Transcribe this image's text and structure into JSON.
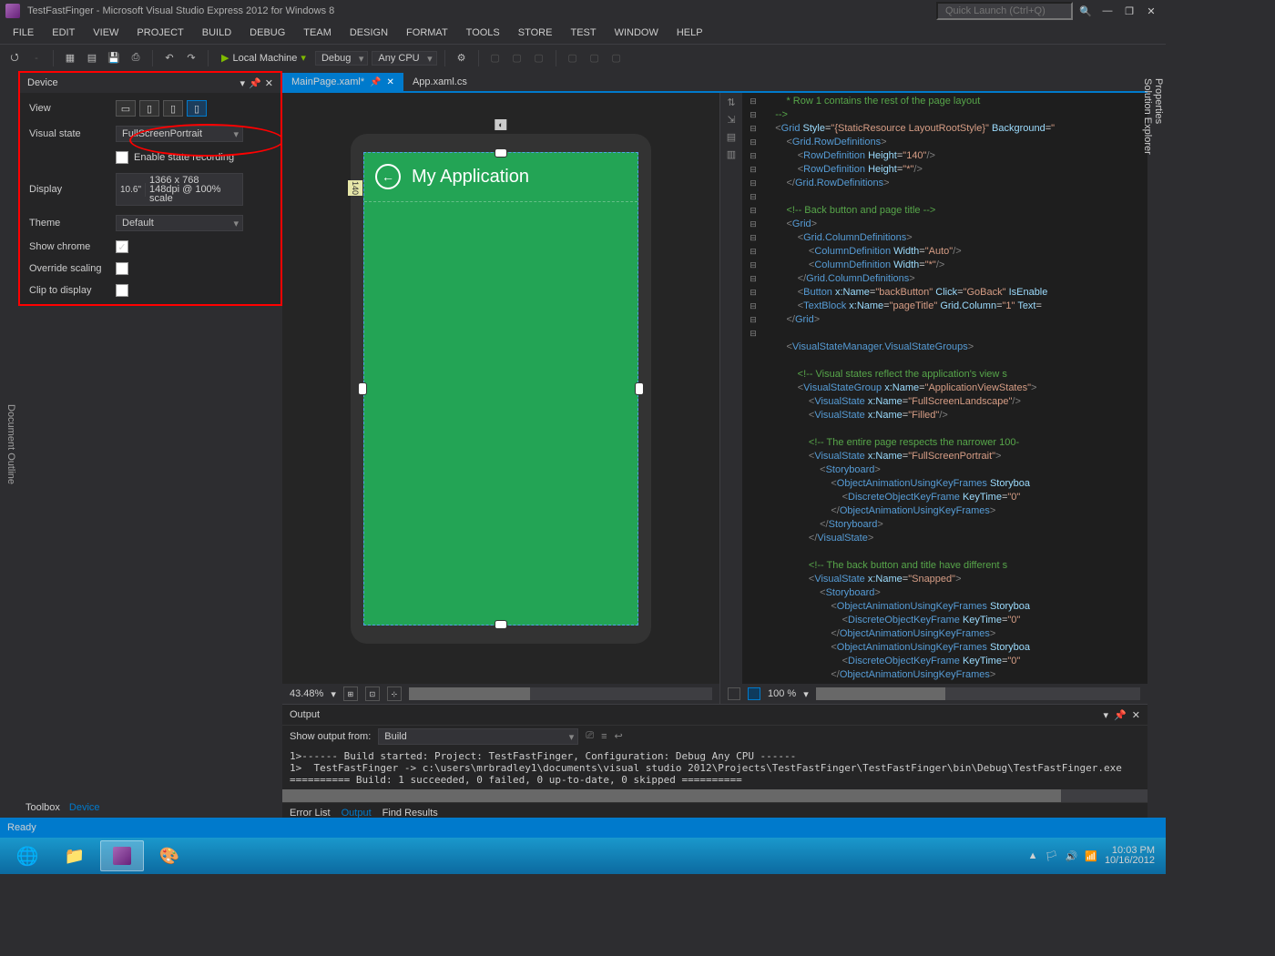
{
  "window": {
    "title": "TestFastFinger - Microsoft Visual Studio Express 2012 for Windows 8",
    "quick_launch_placeholder": "Quick Launch (Ctrl+Q)"
  },
  "menu": [
    "FILE",
    "EDIT",
    "VIEW",
    "PROJECT",
    "BUILD",
    "DEBUG",
    "TEAM",
    "DESIGN",
    "FORMAT",
    "TOOLS",
    "STORE",
    "TEST",
    "WINDOW",
    "HELP"
  ],
  "toolbar": {
    "start_label": "Local Machine",
    "config": "Debug",
    "platform": "Any CPU"
  },
  "left_dock_tab": "Document Outline",
  "device_panel": {
    "title": "Device",
    "view_label": "View",
    "visual_state_label": "Visual state",
    "visual_state_value": "FullScreenPortrait",
    "enable_recording_label": "Enable state recording",
    "enable_recording_checked": false,
    "display_label": "Display",
    "display_size": "10.6\"",
    "display_res": "1366 x 768",
    "display_dpi": "148dpi @ 100% scale",
    "theme_label": "Theme",
    "theme_value": "Default",
    "show_chrome_label": "Show chrome",
    "show_chrome_checked": true,
    "override_scaling_label": "Override scaling",
    "override_scaling_checked": false,
    "clip_label": "Clip to display",
    "clip_checked": false
  },
  "left_bottom_tabs": {
    "toolbox": "Toolbox",
    "device": "Device"
  },
  "editor_tabs": [
    {
      "label": "MainPage.xaml*",
      "active": true
    },
    {
      "label": "App.xaml.cs",
      "active": false
    }
  ],
  "designer": {
    "app_title": "My Application",
    "ruler_left": "140",
    "zoom": "43.48%"
  },
  "code_zoom": "100 %",
  "code_lines": [
    {
      "indent": 2,
      "text": "* Row 1 contains the rest of the page layout",
      "cls": "c"
    },
    {
      "indent": 1,
      "text": "-->",
      "cls": "c"
    },
    {
      "indent": 1,
      "raw": "<span class='p'>&lt;</span><span class='t'>Grid</span> <span class='a'>Style</span>=<span class='s'>\"{StaticResource LayoutRootStyle}\"</span> <span class='a'>Background</span>=<span class='s'>\""
    },
    {
      "indent": 2,
      "raw": "<span class='p'>&lt;</span><span class='t'>Grid.RowDefinitions</span><span class='p'>&gt;</span>"
    },
    {
      "indent": 3,
      "raw": "<span class='p'>&lt;</span><span class='t'>RowDefinition</span> <span class='a'>Height</span>=<span class='s'>\"140\"</span><span class='p'>/&gt;</span>"
    },
    {
      "indent": 3,
      "raw": "<span class='p'>&lt;</span><span class='t'>RowDefinition</span> <span class='a'>Height</span>=<span class='s'>\"*\"</span><span class='p'>/&gt;</span>"
    },
    {
      "indent": 2,
      "raw": "<span class='p'>&lt;/</span><span class='t'>Grid.RowDefinitions</span><span class='p'>&gt;</span>"
    },
    {
      "indent": 0,
      "raw": "&nbsp;"
    },
    {
      "indent": 2,
      "text": "<!-- Back button and page title -->",
      "cls": "c"
    },
    {
      "indent": 2,
      "raw": "<span class='p'>&lt;</span><span class='t'>Grid</span><span class='p'>&gt;</span>"
    },
    {
      "indent": 3,
      "raw": "<span class='p'>&lt;</span><span class='t'>Grid.ColumnDefinitions</span><span class='p'>&gt;</span>"
    },
    {
      "indent": 4,
      "raw": "<span class='p'>&lt;</span><span class='t'>ColumnDefinition</span> <span class='a'>Width</span>=<span class='s'>\"Auto\"</span><span class='p'>/&gt;</span>"
    },
    {
      "indent": 4,
      "raw": "<span class='p'>&lt;</span><span class='t'>ColumnDefinition</span> <span class='a'>Width</span>=<span class='s'>\"*\"</span><span class='p'>/&gt;</span>"
    },
    {
      "indent": 3,
      "raw": "<span class='p'>&lt;/</span><span class='t'>Grid.ColumnDefinitions</span><span class='p'>&gt;</span>"
    },
    {
      "indent": 3,
      "raw": "<span class='p'>&lt;</span><span class='t'>Button</span> <span class='a'>x:Name</span>=<span class='s'>\"backButton\"</span> <span class='a'>Click</span>=<span class='s'>\"GoBack\"</span> <span class='a'>IsEnable"
    },
    {
      "indent": 3,
      "raw": "<span class='p'>&lt;</span><span class='t'>TextBlock</span> <span class='a'>x:Name</span>=<span class='s'>\"pageTitle\"</span> <span class='a'>Grid.Column</span>=<span class='s'>\"1\"</span> <span class='a'>Text</span>="
    },
    {
      "indent": 2,
      "raw": "<span class='p'>&lt;/</span><span class='t'>Grid</span><span class='p'>&gt;</span>"
    },
    {
      "indent": 0,
      "raw": "&nbsp;"
    },
    {
      "indent": 2,
      "raw": "<span class='p'>&lt;</span><span class='t'>VisualStateManager.VisualStateGroups</span><span class='p'>&gt;</span>"
    },
    {
      "indent": 0,
      "raw": "&nbsp;"
    },
    {
      "indent": 3,
      "text": "<!-- Visual states reflect the application's view s",
      "cls": "c"
    },
    {
      "indent": 3,
      "raw": "<span class='p'>&lt;</span><span class='t'>VisualStateGroup</span> <span class='a'>x:Name</span>=<span class='s'>\"ApplicationViewStates\"</span><span class='p'>&gt;</span>"
    },
    {
      "indent": 4,
      "raw": "<span class='p'>&lt;</span><span class='t'>VisualState</span> <span class='a'>x:Name</span>=<span class='s'>\"FullScreenLandscape\"</span><span class='p'>/&gt;</span>"
    },
    {
      "indent": 4,
      "raw": "<span class='p'>&lt;</span><span class='t'>VisualState</span> <span class='a'>x:Name</span>=<span class='s'>\"Filled\"</span><span class='p'>/&gt;</span>"
    },
    {
      "indent": 0,
      "raw": "&nbsp;"
    },
    {
      "indent": 4,
      "text": "<!-- The entire page respects the narrower 100-",
      "cls": "c"
    },
    {
      "indent": 4,
      "raw": "<span class='p'>&lt;</span><span class='t'>VisualState</span> <span class='a'>x:Name</span>=<span class='s'>\"FullScreenPortrait\"</span><span class='p'>&gt;</span>"
    },
    {
      "indent": 5,
      "raw": "<span class='p'>&lt;</span><span class='t'>Storyboard</span><span class='p'>&gt;</span>"
    },
    {
      "indent": 6,
      "raw": "<span class='p'>&lt;</span><span class='t'>ObjectAnimationUsingKeyFrames</span> <span class='a'>Storyboa"
    },
    {
      "indent": 7,
      "raw": "<span class='p'>&lt;</span><span class='t'>DiscreteObjectKeyFrame</span> <span class='a'>KeyTime</span>=<span class='s'>\"0\""
    },
    {
      "indent": 6,
      "raw": "<span class='p'>&lt;/</span><span class='t'>ObjectAnimationUsingKeyFrames</span><span class='p'>&gt;</span>"
    },
    {
      "indent": 5,
      "raw": "<span class='p'>&lt;/</span><span class='t'>Storyboard</span><span class='p'>&gt;</span>"
    },
    {
      "indent": 4,
      "raw": "<span class='p'>&lt;/</span><span class='t'>VisualState</span><span class='p'>&gt;</span>"
    },
    {
      "indent": 0,
      "raw": "&nbsp;"
    },
    {
      "indent": 4,
      "text": "<!-- The back button and title have different s",
      "cls": "c"
    },
    {
      "indent": 4,
      "raw": "<span class='p'>&lt;</span><span class='t'>VisualState</span> <span class='a'>x:Name</span>=<span class='s'>\"Snapped\"</span><span class='p'>&gt;</span>"
    },
    {
      "indent": 5,
      "raw": "<span class='p'>&lt;</span><span class='t'>Storyboard</span><span class='p'>&gt;</span>"
    },
    {
      "indent": 6,
      "raw": "<span class='p'>&lt;</span><span class='t'>ObjectAnimationUsingKeyFrames</span> <span class='a'>Storyboa"
    },
    {
      "indent": 7,
      "raw": "<span class='p'>&lt;</span><span class='t'>DiscreteObjectKeyFrame</span> <span class='a'>KeyTime</span>=<span class='s'>\"0\""
    },
    {
      "indent": 6,
      "raw": "<span class='p'>&lt;/</span><span class='t'>ObjectAnimationUsingKeyFrames</span><span class='p'>&gt;</span>"
    },
    {
      "indent": 6,
      "raw": "<span class='p'>&lt;</span><span class='t'>ObjectAnimationUsingKeyFrames</span> <span class='a'>Storyboa"
    },
    {
      "indent": 7,
      "raw": "<span class='p'>&lt;</span><span class='t'>DiscreteObjectKeyFrame</span> <span class='a'>KeyTime</span>=<span class='s'>\"0\""
    },
    {
      "indent": 6,
      "raw": "<span class='p'>&lt;/</span><span class='t'>ObjectAnimationUsingKeyFrames</span><span class='p'>&gt;</span>"
    }
  ],
  "output": {
    "title": "Output",
    "show_from_label": "Show output from:",
    "show_from_value": "Build",
    "text": "1>------ Build started: Project: TestFastFinger, Configuration: Debug Any CPU ------\n1>  TestFastFinger -> c:\\users\\mrbradley1\\documents\\visual studio 2012\\Projects\\TestFastFinger\\TestFastFinger\\bin\\Debug\\TestFastFinger.exe\n========== Build: 1 succeeded, 0 failed, 0 up-to-date, 0 skipped ==========",
    "bottom_tabs": {
      "error": "Error List",
      "output": "Output",
      "find": "Find Results"
    }
  },
  "right_dock": [
    "Properties",
    "Solution Explorer"
  ],
  "status": "Ready",
  "taskbar": {
    "time": "10:03 PM",
    "date": "10/16/2012"
  }
}
